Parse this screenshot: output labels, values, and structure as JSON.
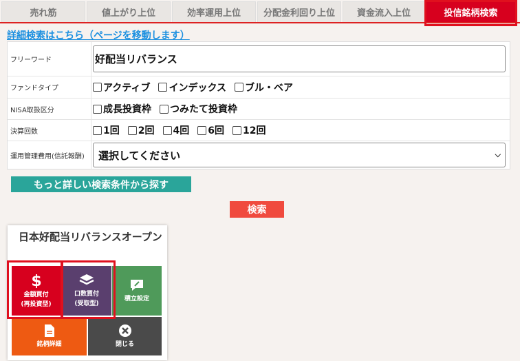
{
  "tabs": [
    {
      "label": "売れ筋"
    },
    {
      "label": "値上がり上位"
    },
    {
      "label": "効率運用上位"
    },
    {
      "label": "分配金利回り上位"
    },
    {
      "label": "資金流入上位"
    },
    {
      "label": "投信銘柄検索"
    }
  ],
  "active_tab": "投信銘柄検索",
  "detail_link": "詳細検索はこちら（ページを移動します）",
  "form": {
    "freeword": {
      "label": "フリーワード",
      "value": "好配当リバランス"
    },
    "fund_type": {
      "label": "ファンドタイプ",
      "options": [
        "アクティブ",
        "インデックス",
        "ブル・ベア"
      ]
    },
    "nisa": {
      "label": "NISA取扱区分",
      "options": [
        "成長投資枠",
        "つみたて投資枠"
      ]
    },
    "settlement": {
      "label": "決算回数",
      "options": [
        "1回",
        "2回",
        "4回",
        "6回",
        "12回"
      ]
    },
    "cost": {
      "label": "運用管理費用(信託報酬)",
      "selected": "選択してください"
    }
  },
  "more_button": "もっと詳しい検索条件から探す",
  "search_button": "検索",
  "card": {
    "title": "日本好配当リバランスオープン",
    "actions": [
      {
        "line1": "金額買付",
        "line2": "(再投資型)",
        "icon": "dollar-icon",
        "color": "#d7001e"
      },
      {
        "line1": "口数買付",
        "line2": "(受取型)",
        "icon": "layers-icon",
        "color": "#5a3f6e"
      },
      {
        "line1": "積立設定",
        "line2": "",
        "icon": "edit-icon",
        "color": "#4f9a5a"
      },
      {
        "line1": "銘柄詳細",
        "line2": "",
        "icon": "document-icon",
        "color": "#ee5a12"
      },
      {
        "line1": "閉じる",
        "line2": "",
        "icon": "close-icon",
        "color": "#4a4a4a"
      }
    ]
  }
}
